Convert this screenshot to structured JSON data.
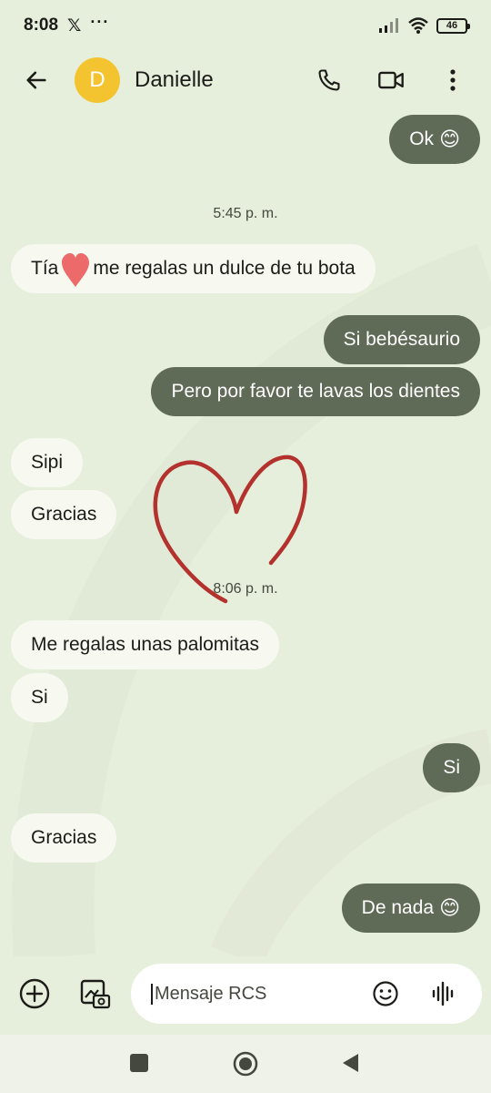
{
  "status_bar": {
    "time": "8:08",
    "x_icon": "x-logo-icon",
    "dots": "···",
    "battery": "46"
  },
  "header": {
    "avatar_letter": "D",
    "contact_name": "Danielle",
    "icons": [
      "back-arrow-icon",
      "phone-icon",
      "video-call-icon",
      "more-vert-icon"
    ]
  },
  "messages": [
    {
      "dir": "out",
      "text": "Ok",
      "emoji": "😊"
    },
    {
      "type": "timestamp",
      "text": "5:45 p. m."
    },
    {
      "dir": "in",
      "text_before": "Tía",
      "heart": "❤️",
      "text_after": "me regalas un dulce de tu bota"
    },
    {
      "dir": "out",
      "text": "Si bebésaurio"
    },
    {
      "dir": "out",
      "text": "Pero por favor te lavas los dientes"
    },
    {
      "dir": "in",
      "text": "Sipi"
    },
    {
      "dir": "in",
      "text": "Gracias"
    },
    {
      "type": "timestamp",
      "text": "8:06 p. m."
    },
    {
      "dir": "in",
      "text": "Me regalas unas palomitas"
    },
    {
      "dir": "in",
      "text": "Si"
    },
    {
      "dir": "out",
      "text": "Si"
    },
    {
      "dir": "in",
      "text": "Gracias"
    },
    {
      "dir": "out",
      "text": "De nada",
      "emoji": "😊"
    }
  ],
  "composer": {
    "placeholder": "Mensaje RCS",
    "value": ""
  },
  "colors": {
    "background": "#e6eedc",
    "incoming_bubble": "#f7f9f1",
    "outgoing_bubble": "#5f6a57",
    "avatar": "#f4c430",
    "heart_doodle": "#b3322d"
  }
}
